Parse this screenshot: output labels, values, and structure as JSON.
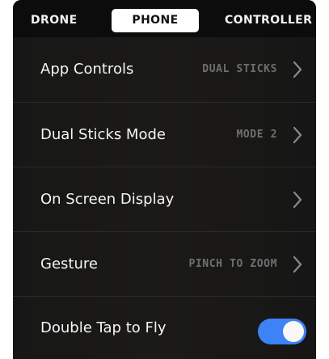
{
  "tabs": {
    "drone": "DRONE",
    "phone": "PHONE",
    "controller": "CONTROLLER",
    "active": "PHONE"
  },
  "settings": [
    {
      "label": "App Controls",
      "value": "DUAL STICKS",
      "icon": "chevron-right-icon"
    },
    {
      "label": "Dual Sticks Mode",
      "value": "MODE 2",
      "icon": "chevron-right-icon"
    },
    {
      "label": "On Screen Display",
      "value": "",
      "icon": "chevron-right-icon"
    },
    {
      "label": "Gesture",
      "value": "PINCH TO ZOOM",
      "icon": "chevron-right-icon"
    }
  ],
  "double_tap": {
    "label": "Double Tap to Fly",
    "enabled": true
  },
  "colors": {
    "background": "#161616",
    "tab_bar": "#0c0c0c",
    "active_tab": "#ffffff",
    "value_text": "#6f6f6f",
    "toggle_on": "#3d82f6"
  }
}
